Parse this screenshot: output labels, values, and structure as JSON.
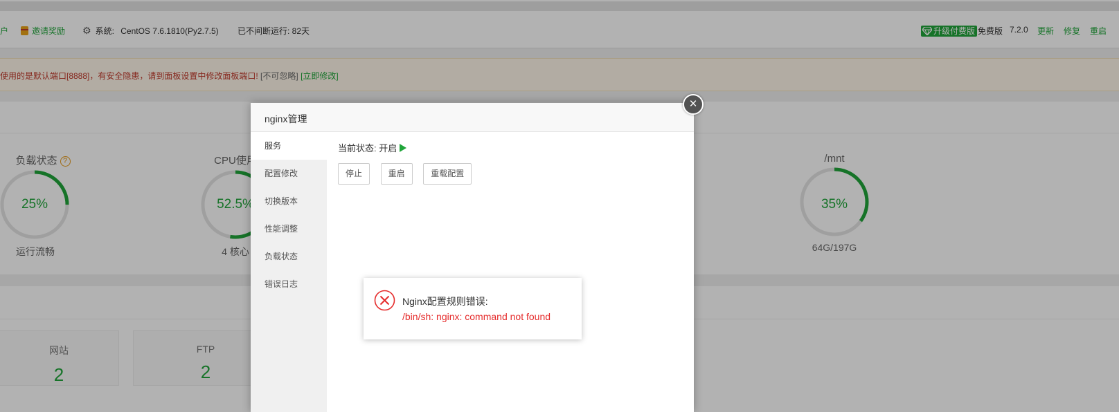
{
  "topbar": {
    "account_fragment": "户",
    "invite_label": "邀请奖励",
    "system_label": "系统:",
    "system_value": "CentOS 7.6.1810(Py2.7.5)",
    "uptime": "已不间断运行: 82天",
    "upgrade_label": "升级付费版",
    "edition": "免费版",
    "version": "7.2.0",
    "update_label": "更新",
    "repair_label": "修复",
    "restart_label": "重启"
  },
  "warning": {
    "text": "使用的是默认端口[8888]，有安全隐患，请到面板设置中修改面板端口!",
    "ignore": "[不可忽略]",
    "fix": "[立即修改]"
  },
  "status": {
    "gauges": [
      {
        "title": "负载状态",
        "percent": 25,
        "value": "25%",
        "sub": "运行流畅"
      },
      {
        "title": "CPU使用",
        "percent": 52.5,
        "value": "52.5%",
        "sub": "4 核心"
      },
      {
        "title": "/mnt",
        "percent": 35,
        "value": "35%",
        "sub": "64G/197G"
      }
    ]
  },
  "overview": {
    "cards": [
      {
        "label": "网站",
        "value": "2"
      },
      {
        "label": "FTP",
        "value": "2"
      }
    ]
  },
  "modal": {
    "title": "nginx管理",
    "menu": [
      "服务",
      "配置修改",
      "切换版本",
      "性能调整",
      "负载状态",
      "错误日志"
    ],
    "status_label": "当前状态:",
    "status_value": "开启",
    "buttons": [
      "停止",
      "重启",
      "重载配置"
    ]
  },
  "popup": {
    "title": "Nginx配置规则错误:",
    "message": "/bin/sh: nginx: command not found"
  },
  "colors": {
    "accent": "#20a53a",
    "error": "#e52b2b",
    "warning_text": "#c0392b"
  }
}
